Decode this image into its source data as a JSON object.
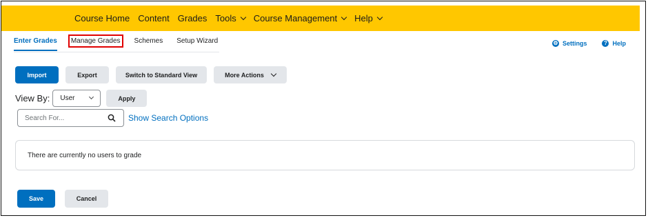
{
  "topnav": {
    "items": [
      {
        "label": "Course Home",
        "dropdown": false
      },
      {
        "label": "Content",
        "dropdown": false
      },
      {
        "label": "Grades",
        "dropdown": false
      },
      {
        "label": "Tools",
        "dropdown": true
      },
      {
        "label": "Course Management",
        "dropdown": true
      },
      {
        "label": "Help",
        "dropdown": true
      }
    ]
  },
  "tabs": {
    "enter_grades": "Enter Grades",
    "manage_grades": "Manage Grades",
    "schemes": "Schemes",
    "setup_wizard": "Setup Wizard"
  },
  "tools": {
    "settings": "Settings",
    "help": "Help"
  },
  "actions": {
    "import": "Import",
    "export": "Export",
    "switch_view": "Switch to Standard View",
    "more_actions": "More Actions"
  },
  "viewby": {
    "label": "View By:",
    "selected": "User",
    "apply": "Apply"
  },
  "search": {
    "placeholder": "Search For...",
    "options_link": "Show Search Options"
  },
  "message": "There are currently no users to grade",
  "footer": {
    "save": "Save",
    "cancel": "Cancel"
  },
  "colors": {
    "navbar": "#ffc700",
    "primary": "#006fbf",
    "highlight": "#e00000"
  }
}
